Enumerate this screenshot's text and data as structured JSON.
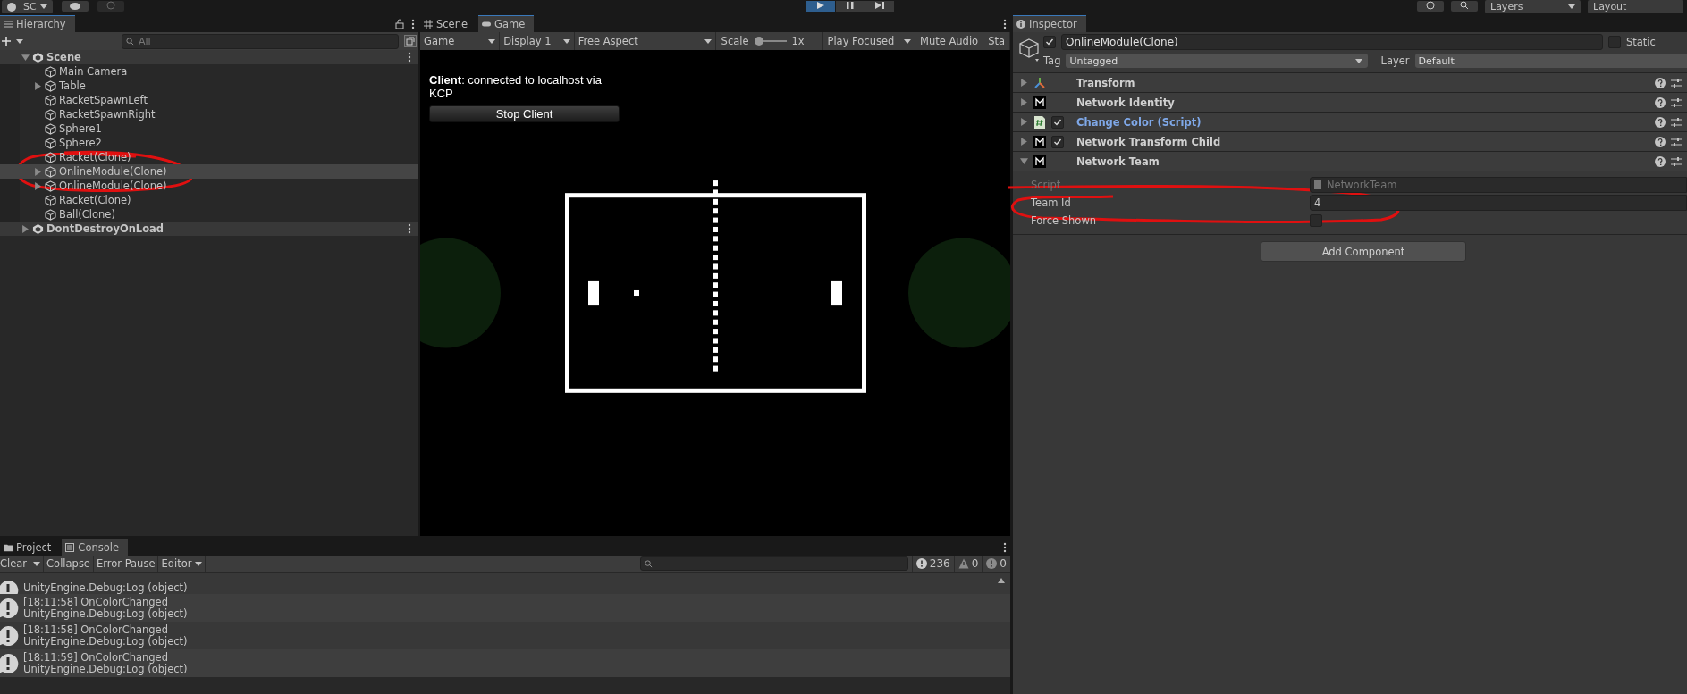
{
  "toolbar": {
    "account": "SC",
    "playing": true,
    "paused": false,
    "layers": "Layers",
    "layout": "Layout"
  },
  "hierarchy": {
    "title": "Hierarchy",
    "search": {
      "placeholder": "All"
    },
    "roots": [
      {
        "name": "Scene",
        "expanded": true,
        "children": [
          {
            "name": "Main Camera",
            "has_children": false,
            "selected": false
          },
          {
            "name": "Table",
            "has_children": true,
            "selected": false
          },
          {
            "name": "RacketSpawnLeft",
            "has_children": false,
            "selected": false
          },
          {
            "name": "RacketSpawnRight",
            "has_children": false,
            "selected": false
          },
          {
            "name": "Sphere1",
            "has_children": false,
            "selected": false
          },
          {
            "name": "Sphere2",
            "has_children": false,
            "selected": false
          },
          {
            "name": "Racket(Clone)",
            "has_children": false,
            "selected": false
          },
          {
            "name": "OnlineModule(Clone)",
            "has_children": true,
            "selected": true
          },
          {
            "name": "OnlineModule(Clone)",
            "has_children": true,
            "selected": false
          },
          {
            "name": "Racket(Clone)",
            "has_children": false,
            "selected": false
          },
          {
            "name": "Ball(Clone)",
            "has_children": false,
            "selected": false
          }
        ]
      },
      {
        "name": "DontDestroyOnLoad",
        "expanded": false
      }
    ]
  },
  "game": {
    "tabs": [
      {
        "label": "Scene",
        "selected": false
      },
      {
        "label": "Game",
        "selected": true
      }
    ],
    "controls": [
      {
        "kind": "dropdown",
        "label": "Game"
      },
      {
        "kind": "dropdown",
        "label": "Display 1"
      },
      {
        "kind": "dropdown",
        "label": "Free Aspect"
      },
      {
        "kind": "slider",
        "label": "Scale",
        "level": 0,
        "reading": "1x"
      },
      {
        "kind": "dropdown",
        "label": "Play Focused"
      },
      {
        "kind": "toggle",
        "label": "Mute Audio",
        "on": false
      },
      {
        "kind": "toggle",
        "label": "Sta",
        "on": false
      }
    ],
    "status": "**Client**: connected to localhost via KCP",
    "button": "Stop Client"
  },
  "inspector": {
    "title": "Inspector",
    "object": {
      "active": true,
      "name": "OnlineModule(Clone)",
      "static_label": "Static",
      "static": false,
      "tag_label": "Tag",
      "tag": "Untagged",
      "layer_label": "Layer",
      "layer": "Default"
    },
    "components": [
      {
        "kind": "transform",
        "name": "Transform",
        "expanded": false
      },
      {
        "kind": "network",
        "name": "Network Identity",
        "expanded": false
      },
      {
        "kind": "script",
        "name": "Change Color (Script)",
        "enabled": true,
        "expanded": false
      },
      {
        "kind": "network",
        "name": "Network Transform Child",
        "enabled": true,
        "expanded": false
      },
      {
        "kind": "network",
        "name": "Network Team",
        "expanded": true
      }
    ],
    "fields": [
      {
        "kind": "object",
        "label": "Script",
        "value": "NetworkTeam",
        "disabled": true
      },
      {
        "kind": "text",
        "label": "Team Id",
        "value": "4",
        "disabled": false
      },
      {
        "kind": "checkbox",
        "label": "Force Shown",
        "checked": false,
        "disabled": false
      }
    ],
    "add_button": "Add Component"
  },
  "console": {
    "tabs": [
      {
        "label": "Project",
        "selected": false
      },
      {
        "label": "Console",
        "selected": true
      }
    ],
    "buttons": [
      "Clear",
      "Collapse",
      "Error Pause",
      "Editor"
    ],
    "counts": [
      {
        "kind": "info",
        "value": "236"
      },
      {
        "kind": "warning",
        "value": "0"
      },
      {
        "kind": "error",
        "value": "0"
      }
    ],
    "entries": [
      {
        "lines": [
          "UnityEngine.Debug:Log (object)"
        ]
      },
      {
        "lines": [
          "[18:11:58] OnColorChanged",
          "UnityEngine.Debug:Log (object)"
        ]
      },
      {
        "lines": [
          "[18:11:58] OnColorChanged",
          "UnityEngine.Debug:Log (object)"
        ]
      },
      {
        "lines": [
          "[18:11:59] OnColorChanged",
          "UnityEngine.Debug:Log (object)"
        ]
      }
    ]
  }
}
